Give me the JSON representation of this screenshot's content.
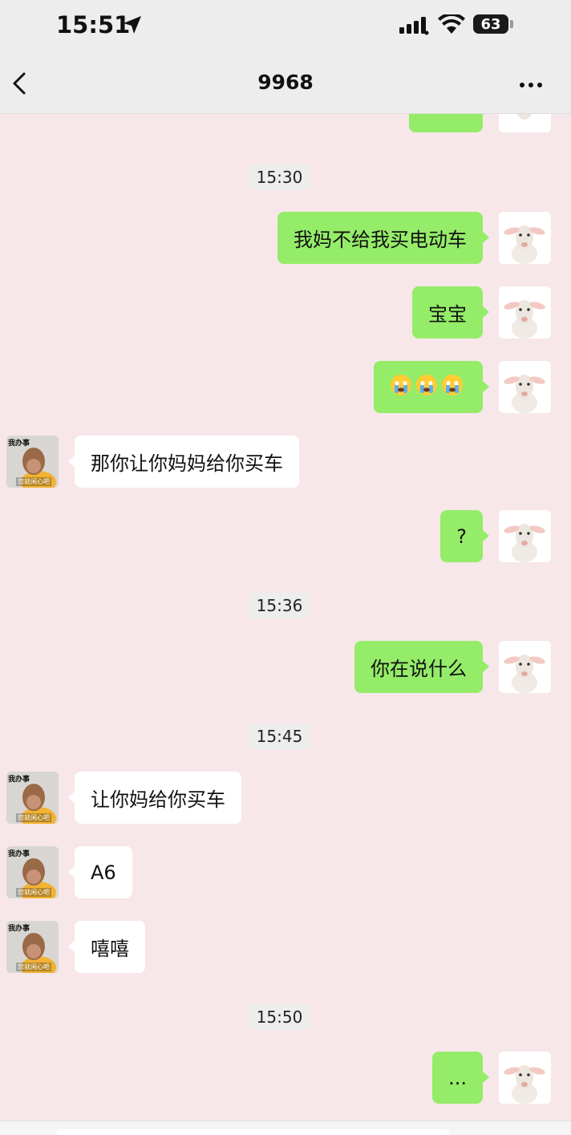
{
  "status_bar": {
    "time": "15:51",
    "battery": "63"
  },
  "nav": {
    "title": "9968"
  },
  "messages": [
    {
      "type": "timestamp",
      "text": "15:30"
    },
    {
      "type": "out",
      "text": "我妈不给我买电动车"
    },
    {
      "type": "out",
      "text": "宝宝"
    },
    {
      "type": "out",
      "text": "😭😭😭",
      "emoji_count": 3
    },
    {
      "type": "in",
      "text": "那你让你妈妈给你买车"
    },
    {
      "type": "out",
      "text": "?"
    },
    {
      "type": "timestamp",
      "text": "15:36"
    },
    {
      "type": "out",
      "text": "你在说什么"
    },
    {
      "type": "timestamp",
      "text": "15:45"
    },
    {
      "type": "in",
      "text": "让你妈给你买车"
    },
    {
      "type": "in",
      "text": "A6"
    },
    {
      "type": "in",
      "text": "嘻嘻"
    },
    {
      "type": "timestamp",
      "text": "15:50"
    },
    {
      "type": "out",
      "text": "..."
    }
  ],
  "avatars": {
    "self": "lamb-avatar",
    "other": "monkey-avatar",
    "other_caption_top": "我办事",
    "other_caption_bottom": "您就闲心吧"
  },
  "colors": {
    "chat_background": "#f7e7e9",
    "outgoing_bubble": "#95ec69",
    "incoming_bubble": "#ffffff",
    "header_background": "#ededed"
  }
}
